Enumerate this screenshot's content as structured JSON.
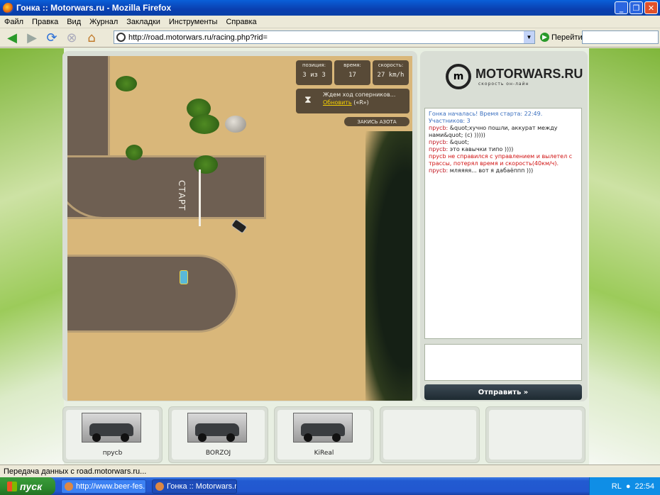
{
  "window": {
    "title": "Гонка :: Motorwars.ru - Mozilla Firefox",
    "min_label": "_",
    "max_label": "❐",
    "close_label": "✕"
  },
  "menu": [
    "Файл",
    "Правка",
    "Вид",
    "Журнал",
    "Закладки",
    "Инструменты",
    "Справка"
  ],
  "nav": {
    "url": "http://road.motorwars.ru/racing.php?rid=",
    "go_label": "Перейти"
  },
  "game": {
    "hud": [
      {
        "label": "позиция:",
        "value": "3 из 3"
      },
      {
        "label": "время:",
        "value": "17"
      },
      {
        "label": "скорость:",
        "value": "27 km/h"
      }
    ],
    "wait_text": "Ждем ход соперников...",
    "refresh_label": "Обновить",
    "refresh_hint": "(«R»)",
    "nitro_label": "ЗАКИСЬ АЗОТА",
    "start_label": "СТАРТ"
  },
  "sidebar": {
    "brand": "MOTORWARS.RU",
    "slogan": "скорость он-лайн",
    "chat": [
      {
        "type": "sys",
        "text": "Гонка началась! Время старта: 22:49."
      },
      {
        "type": "sys",
        "text": "Участников: 3"
      },
      {
        "type": "user",
        "user": "прусb:",
        "text": "&quot;хучно пошли, аккурат между нами&quot; (с) )))))"
      },
      {
        "type": "user",
        "user": "прусb:",
        "text": "&quot;"
      },
      {
        "type": "user",
        "user": "прусb:",
        "text": "это кавычки типо ))))"
      },
      {
        "type": "alert",
        "text": "прусb не справился с управлением и вылетел с трассы, потерял время и скорость(40км/ч)."
      },
      {
        "type": "user",
        "user": "прусb:",
        "text": "мляяяя... вот я дабаёппп )))"
      }
    ],
    "send_label": "Отправить »"
  },
  "players": [
    {
      "name": "прусb"
    },
    {
      "name": "BORZOJ"
    },
    {
      "name": "KiReal"
    },
    {
      "name": ""
    },
    {
      "name": ""
    }
  ],
  "status": "Передача данных с road.motorwars.ru...",
  "taskbar": {
    "start_label": "пуск",
    "tasks": [
      "http://www.beer-fes...",
      "Гонка :: Motorwars.ru..."
    ],
    "lang": "RL",
    "clock": "22:54"
  }
}
